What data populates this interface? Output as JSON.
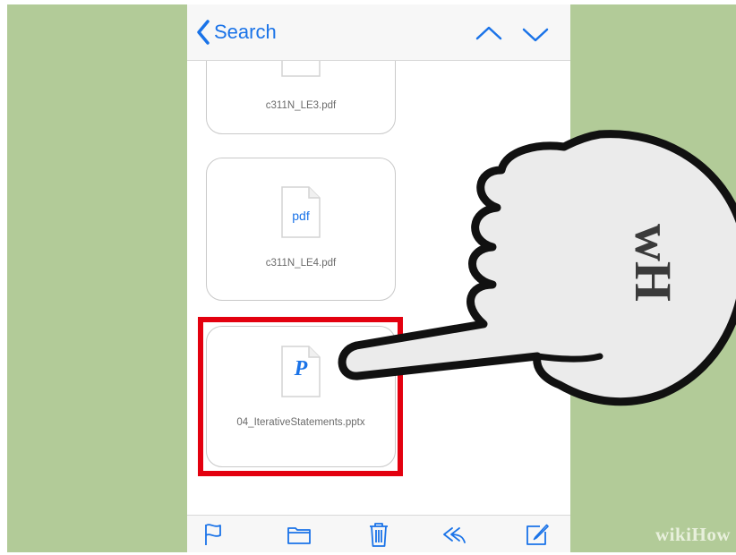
{
  "navbar": {
    "back_label": "Search"
  },
  "attachments": [
    {
      "filename": "c311N_LE3.pdf",
      "icon_text": ""
    },
    {
      "filename": "c311N_LE4.pdf",
      "icon_text": "pdf"
    },
    {
      "filename": "04_IterativeStatements.pptx",
      "icon_text": "P"
    }
  ],
  "toolbar": {
    "icons": [
      "flag-icon",
      "folder-icon",
      "trash-icon",
      "reply-icon",
      "compose-icon"
    ]
  },
  "overlay": {
    "hand_logo": "wH",
    "watermark": "wikiHow"
  },
  "colors": {
    "accent": "#1a73e8",
    "highlight": "#e3000f",
    "background": "#b2cb98"
  }
}
